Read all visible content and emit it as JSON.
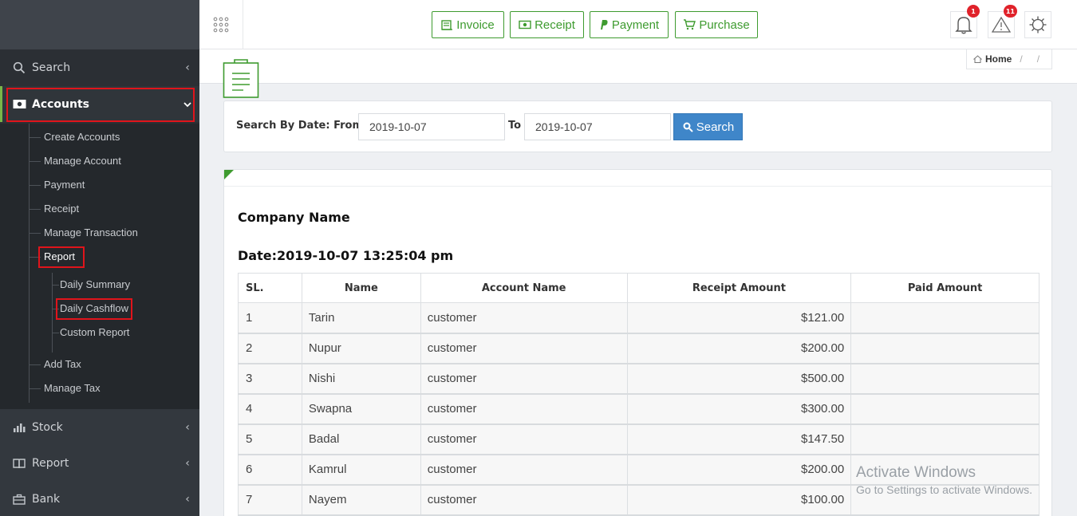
{
  "sidebar": {
    "search": "Search",
    "accounts": "Accounts",
    "sub_items": {
      "create_accounts": "Create Accounts",
      "manage_account": "Manage Account",
      "payment": "Payment",
      "receipt": "Receipt",
      "manage_transaction": "Manage Transaction",
      "report": "Report",
      "daily_summary": "Daily Summary",
      "daily_cashflow": "Daily Cashflow",
      "custom_report": "Custom Report",
      "add_tax": "Add Tax",
      "manage_tax": "Manage Tax"
    },
    "stock": "Stock",
    "report": "Report",
    "bank": "Bank"
  },
  "topbar": {
    "invoice": "Invoice",
    "receipt": "Receipt",
    "payment": "Payment",
    "purchase": "Purchase",
    "notifications_count": "1",
    "alerts_count": "11"
  },
  "breadcrumb": {
    "home": "Home",
    "sep1": "/",
    "sep2": "/"
  },
  "search": {
    "label_from": "Search By Date: From",
    "from_value": "2019-10-07",
    "label_to": "To",
    "to_value": "2019-10-07",
    "button": "Search"
  },
  "report": {
    "company": "Company Name",
    "date": "Date:2019-10-07 13:25:04 pm",
    "headers": [
      "SL.",
      "Name",
      "Account Name",
      "Receipt Amount",
      "Paid Amount"
    ],
    "rows": [
      [
        "1",
        "Tarin",
        "customer",
        "$121.00",
        ""
      ],
      [
        "2",
        "Nupur",
        "customer",
        "$200.00",
        ""
      ],
      [
        "3",
        "Nishi",
        "customer",
        "$500.00",
        ""
      ],
      [
        "4",
        "Swapna",
        "customer",
        "$300.00",
        ""
      ],
      [
        "5",
        "Badal",
        "customer",
        "$147.50",
        ""
      ],
      [
        "6",
        "Kamrul",
        "customer",
        "$200.00",
        ""
      ],
      [
        "7",
        "Nayem",
        "customer",
        "$100.00",
        ""
      ]
    ]
  },
  "watermark": {
    "line1": "Activate Windows",
    "line2": "Go to Settings to activate Windows."
  },
  "colors": {
    "accent_green": "#3e9b2f",
    "search_blue": "#3f86c9",
    "highlight_red": "#e0141b",
    "sidebar_bg": "#2b2f34"
  }
}
